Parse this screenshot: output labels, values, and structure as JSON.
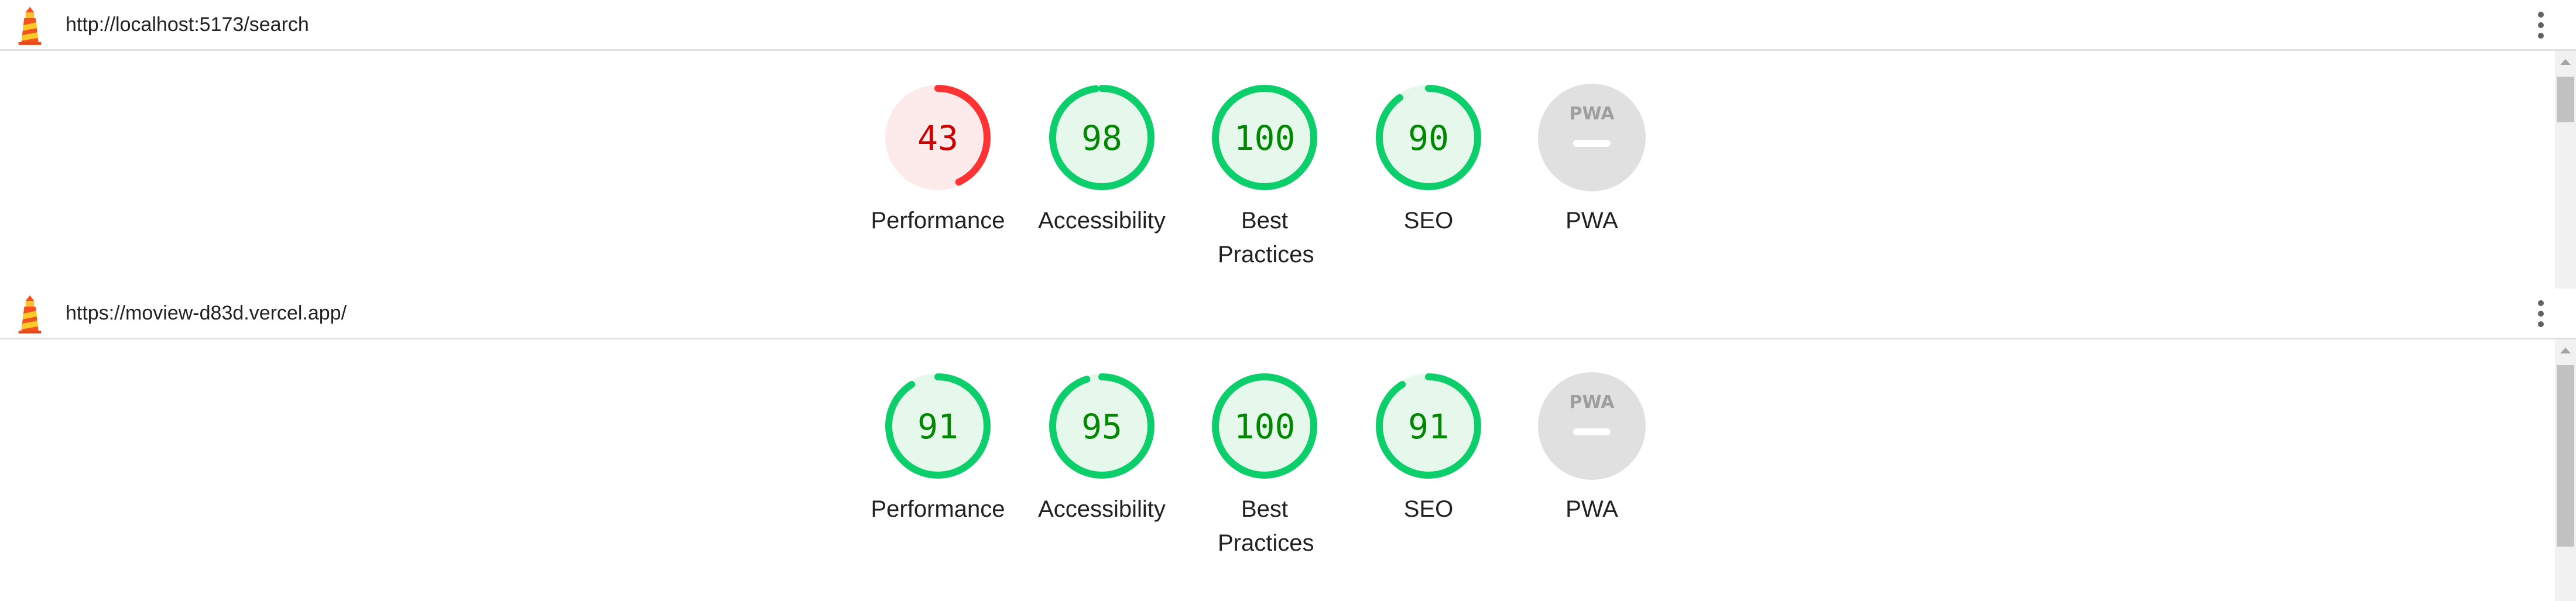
{
  "reports": [
    {
      "url": "http://localhost:5173/search",
      "categories": [
        {
          "label": "Performance",
          "score": "43",
          "value": 43,
          "rating": "fail"
        },
        {
          "label": "Accessibility",
          "score": "98",
          "value": 98,
          "rating": "pass"
        },
        {
          "label": "Best Practices",
          "score": "100",
          "value": 100,
          "rating": "pass"
        },
        {
          "label": "SEO",
          "score": "90",
          "value": 90,
          "rating": "pass"
        },
        {
          "label": "PWA",
          "badge": "PWA",
          "rating": "na"
        }
      ]
    },
    {
      "url": "https://moview-d83d.vercel.app/",
      "categories": [
        {
          "label": "Performance",
          "score": "91",
          "value": 91,
          "rating": "pass"
        },
        {
          "label": "Accessibility",
          "score": "95",
          "value": 95,
          "rating": "pass"
        },
        {
          "label": "Best Practices",
          "score": "100",
          "value": 100,
          "rating": "pass"
        },
        {
          "label": "SEO",
          "score": "91",
          "value": 91,
          "rating": "pass"
        },
        {
          "label": "PWA",
          "badge": "PWA",
          "rating": "na"
        }
      ]
    }
  ],
  "colors": {
    "pass_ring": "#0cce6b",
    "pass_fill": "#e6f7ec",
    "pass_text": "#008800",
    "fail_ring": "#ff3333",
    "fail_fill": "#fdeaea",
    "fail_text": "#cc0000",
    "na_fill": "#e0e0e0",
    "na_text": "#9e9e9e"
  }
}
